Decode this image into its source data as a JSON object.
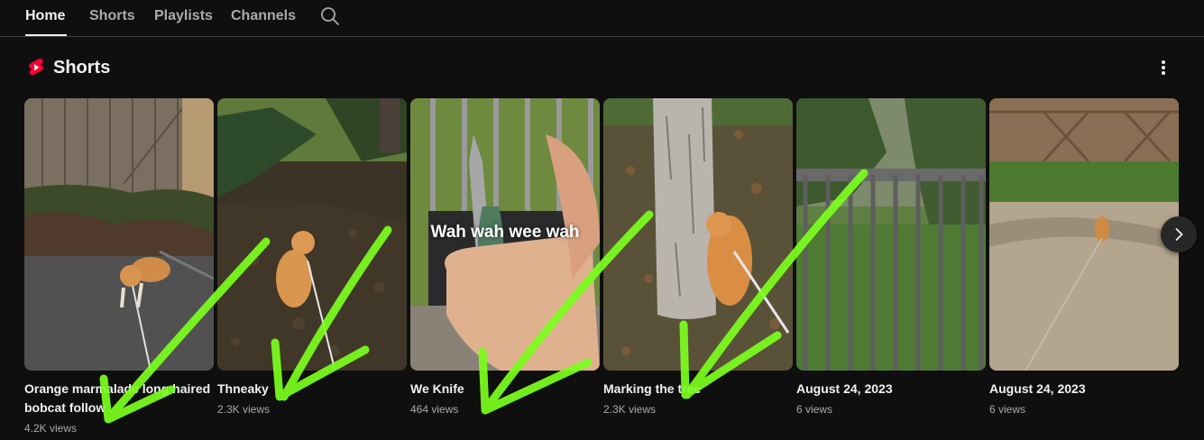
{
  "tabs": [
    {
      "label": "Home",
      "active": true
    },
    {
      "label": "Shorts",
      "active": false
    },
    {
      "label": "Playlists",
      "active": false
    },
    {
      "label": "Channels",
      "active": false
    }
  ],
  "search_icon": "search-icon",
  "section": {
    "title": "Shorts",
    "icon": "shorts-logo-icon",
    "more_icon": "more-vertical-icon"
  },
  "shorts": [
    {
      "title": "Orange marmalade long haired bobcat follow",
      "views": "4.2K views"
    },
    {
      "title": "Thneaky",
      "views": "2.3K views"
    },
    {
      "title": "We Knife",
      "views": "464 views",
      "overlay_text": "Wah wah wee wah"
    },
    {
      "title": "Marking the tree",
      "views": "2.3K views"
    },
    {
      "title": "August 24, 2023",
      "views": "6 views"
    },
    {
      "title": "August 24, 2023",
      "views": "6 views"
    }
  ],
  "next_icon": "chevron-right-icon",
  "colors": {
    "background": "#0f0f0f",
    "text_primary": "#f1f1f1",
    "text_secondary": "#aaaaaa",
    "shorts_red": "#ff0033",
    "annotation_green": "#7cff1e"
  }
}
